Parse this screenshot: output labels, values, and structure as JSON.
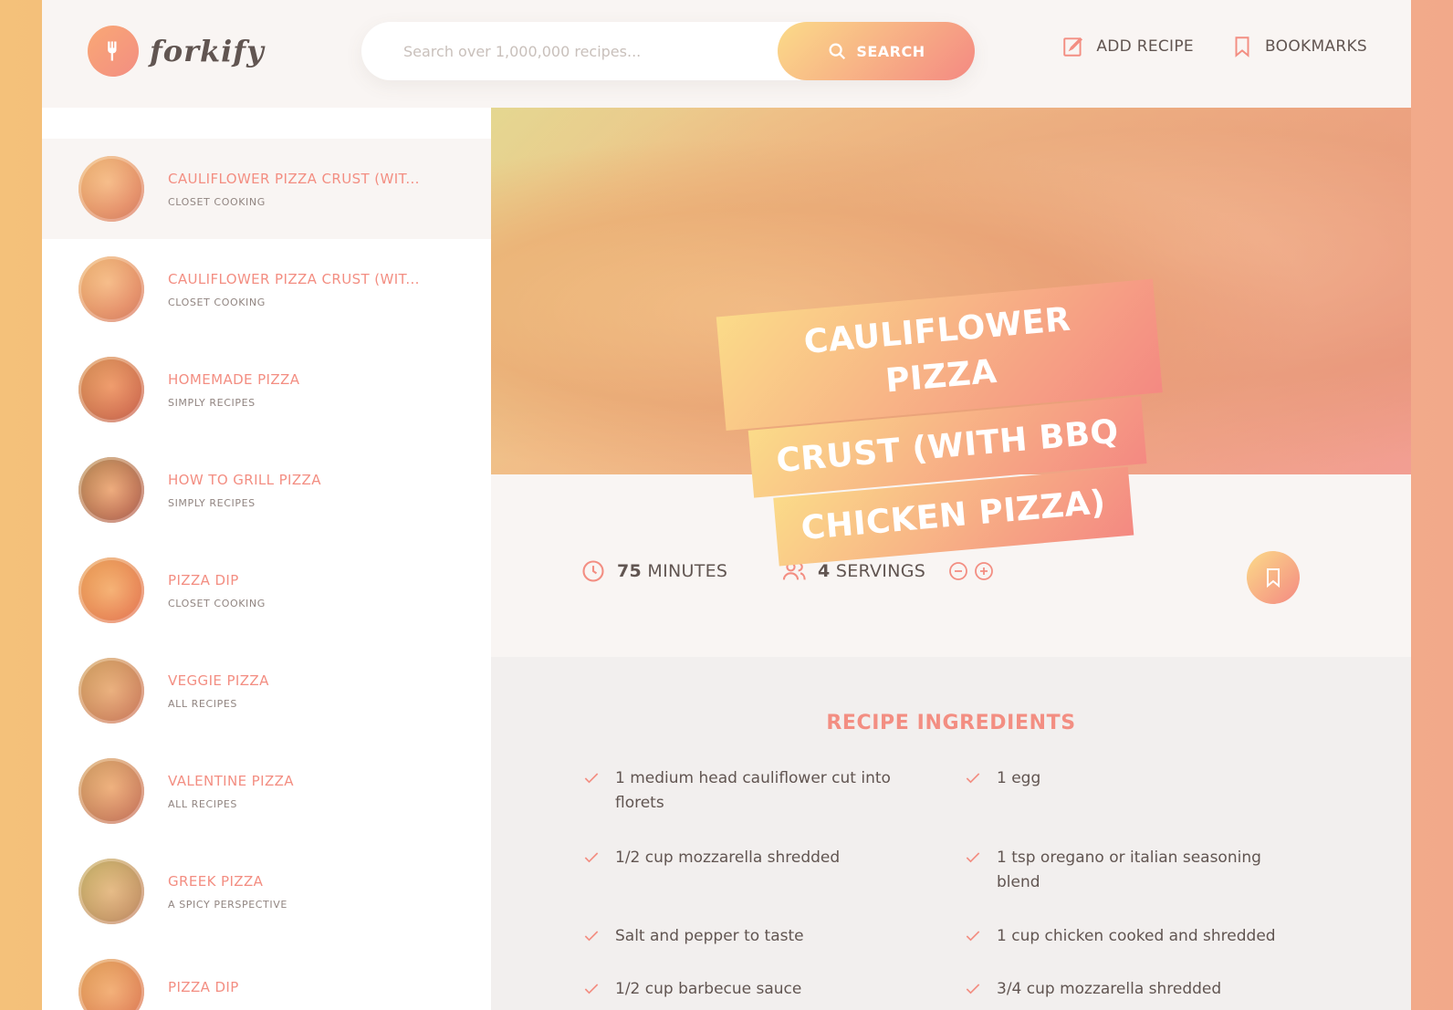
{
  "app": {
    "logo_text": "forkify",
    "colors": {
      "accent_start": "#fbdb89",
      "accent_end": "#f48982",
      "primary": "#f38e82",
      "text": "#615551",
      "bg_light": "#f9f5f3"
    }
  },
  "header": {
    "search": {
      "placeholder": "Search over 1,000,000 recipes...",
      "value": "",
      "button_label": "SEARCH"
    },
    "nav": [
      {
        "label": "ADD RECIPE",
        "icon": "edit-icon"
      },
      {
        "label": "BOOKMARKS",
        "icon": "bookmark-icon"
      }
    ]
  },
  "results": [
    {
      "title": "CAULIFLOWER PIZZA CRUST (WIT...",
      "publisher": "CLOSET COOKING",
      "active": true
    },
    {
      "title": "CAULIFLOWER PIZZA CRUST (WIT...",
      "publisher": "CLOSET COOKING",
      "active": false
    },
    {
      "title": "HOMEMADE PIZZA",
      "publisher": "SIMPLY RECIPES",
      "active": false
    },
    {
      "title": "HOW TO GRILL PIZZA",
      "publisher": "SIMPLY RECIPES",
      "active": false
    },
    {
      "title": "PIZZA DIP",
      "publisher": "CLOSET COOKING",
      "active": false
    },
    {
      "title": "VEGGIE PIZZA",
      "publisher": "ALL RECIPES",
      "active": false
    },
    {
      "title": "VALENTINE PIZZA",
      "publisher": "ALL RECIPES",
      "active": false
    },
    {
      "title": "GREEK PIZZA",
      "publisher": "A SPICY PERSPECTIVE",
      "active": false
    },
    {
      "title": "PIZZA DIP",
      "publisher": "",
      "active": false
    }
  ],
  "recipe": {
    "title_lines": [
      "CAULIFLOWER PIZZA",
      "CRUST (WITH BBQ",
      "CHICKEN PIZZA)"
    ],
    "minutes": "75",
    "minutes_label": "MINUTES",
    "servings": "4",
    "servings_label": "SERVINGS",
    "ingredients_heading": "RECIPE INGREDIENTS",
    "ingredients": [
      "1 medium head cauliflower cut into florets",
      "1 egg",
      "1/2 cup mozzarella shredded",
      "1 tsp oregano or italian seasoning blend",
      "Salt and pepper to taste",
      "1 cup chicken cooked and shredded",
      "1/2 cup barbecue sauce",
      "3/4 cup mozzarella shredded"
    ]
  }
}
